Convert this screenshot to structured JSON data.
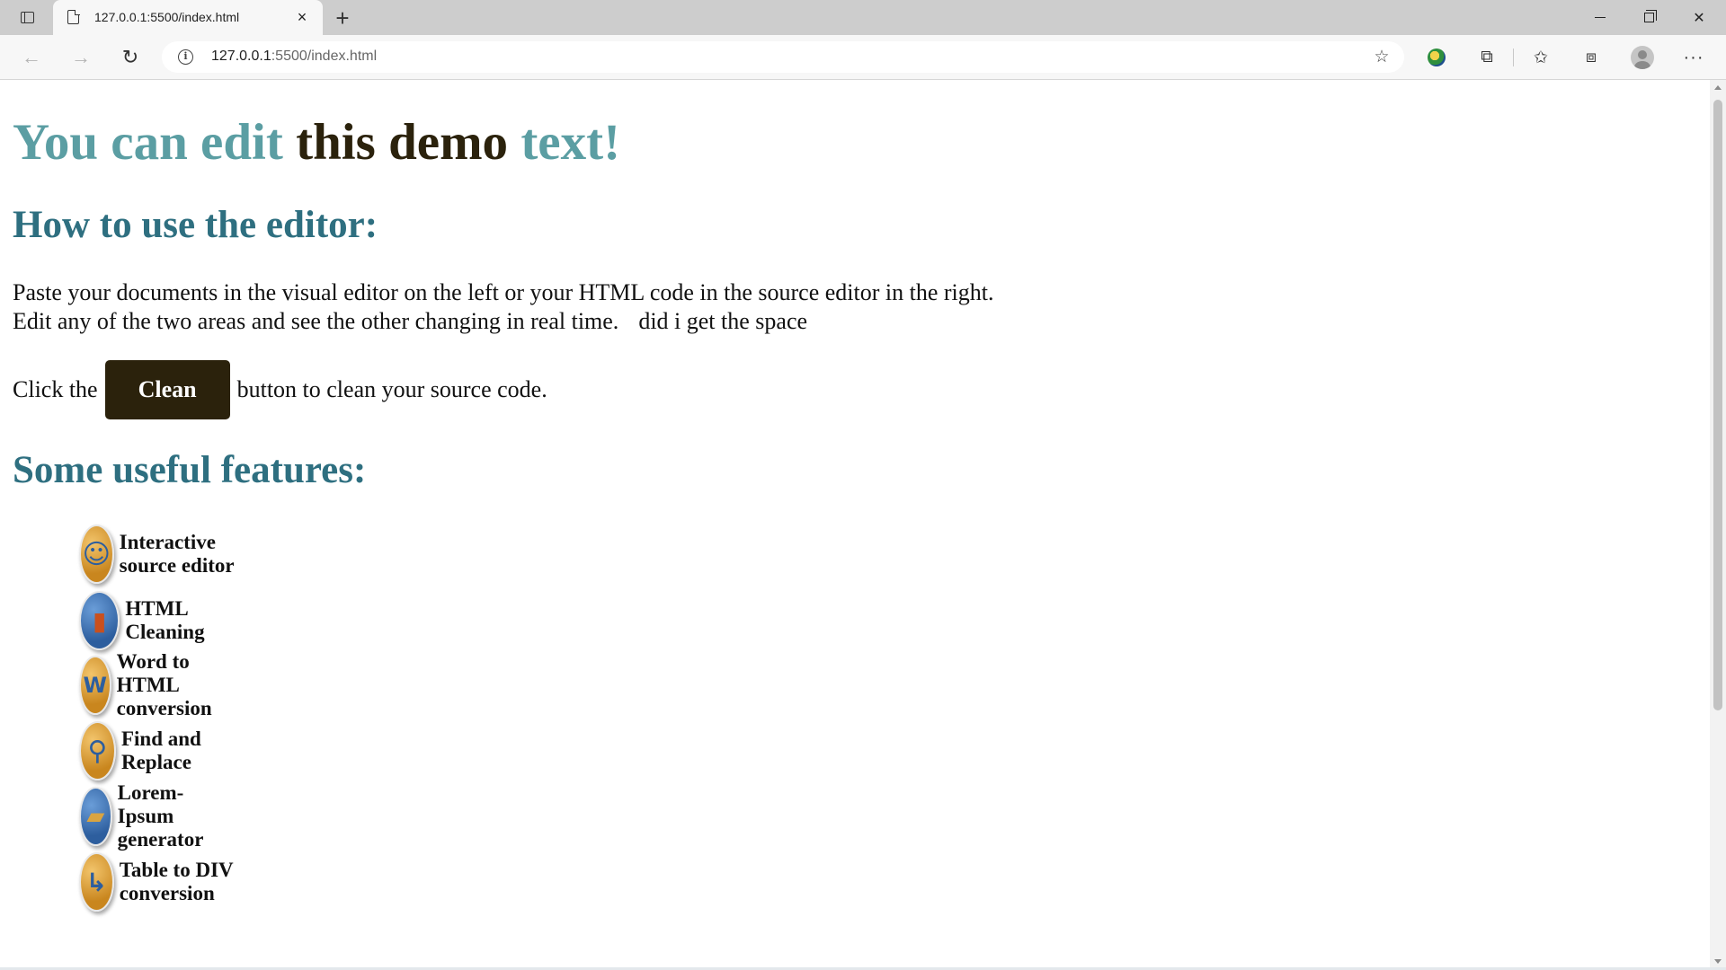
{
  "browser": {
    "tab_title": "127.0.0.1:5500/index.html",
    "tab_close": "×",
    "new_tab": "+",
    "url_host": "127.0.0.1",
    "url_rest": ":5500/index.html",
    "info": "i",
    "icons": {
      "sidebar": "tab-actions-icon",
      "page": "page-icon",
      "back": "arrow-left-icon",
      "forward": "arrow-right-icon",
      "reload": "reload-icon",
      "favorite_add": "star-plus-icon",
      "extension_1": "globe-extension-icon",
      "extensions": "puzzle-icon",
      "favorites": "favorites-icon",
      "collections": "collections-icon",
      "profile": "profile-icon",
      "more": "more-icon"
    }
  },
  "page": {
    "h1_part1": "You can edit",
    "h1_part2": "this demo",
    "h1_part3": "text!",
    "h2_how": "How to use the editor:",
    "para_line1": "Paste your documents in the visual editor on the left or your HTML code in the source editor in the right.",
    "para_line2a": "Edit any of the two areas and see the other changing in real time.",
    "para_line2b": "did i get the space",
    "click_pre": "Click the",
    "clean_button": "Clean",
    "click_post": "button to clean your source code.",
    "h2_features": "Some useful features:",
    "features": [
      {
        "label": "Interactive source editor",
        "icon": "face-icon"
      },
      {
        "label": "HTML Cleaning",
        "icon": "broom-bucket-icon"
      },
      {
        "label": "Word to HTML conversion",
        "icon": "word-document-icon"
      },
      {
        "label": "Find and Replace",
        "icon": "magnifier-icon"
      },
      {
        "label": "Lorem-Ipsum generator",
        "icon": "blah-book-icon"
      },
      {
        "label": "Table to DIV conversion",
        "icon": "table-arrow-icon"
      }
    ]
  },
  "colors": {
    "teal": "#5b9ea3",
    "dark_brown": "#2b220c",
    "heading_blue": "#2e6f80"
  }
}
